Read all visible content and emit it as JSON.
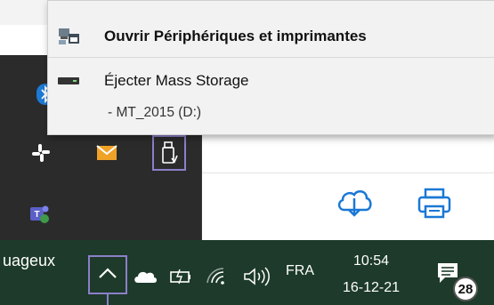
{
  "context_menu": {
    "open_devices_label": "Ouvrir Périphériques et imprimantes",
    "eject_label": "Éjecter Mass Storage",
    "drive_label": "-   MT_2015 (D:)"
  },
  "taskbar": {
    "weather_text": "uageux",
    "language": "FRA",
    "time": "10:54",
    "date": "16-12-21",
    "notification_count": "28"
  },
  "colors": {
    "taskbar_bg": "#1d3a2a",
    "tray_panel_bg": "#2b2b2b",
    "highlight": "#8c7fc9",
    "menu_bg": "#f2f2f2",
    "accent_blue": "#1a78d6"
  },
  "icons": {
    "tray_overflow": [
      "bluetooth-icon",
      "slack-icon",
      "mail-icon",
      "usb-drive-icon",
      "teams-icon"
    ],
    "menu": [
      "devices-printers-icon",
      "drive-icon"
    ],
    "background": [
      "cloud-download-icon",
      "printer-icon"
    ],
    "taskbar": [
      "chevron-up-icon",
      "onedrive-icon",
      "battery-icon",
      "wifi-icon",
      "volume-icon",
      "notification-icon"
    ]
  }
}
